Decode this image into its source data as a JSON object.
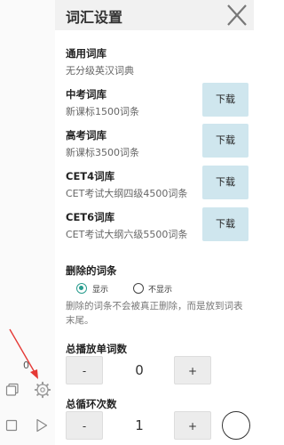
{
  "left_bar": {
    "count": "0"
  },
  "dialog": {
    "title": "词汇设置",
    "general": {
      "title": "通用词库",
      "subtitle": "无分级英汉词典"
    },
    "libraries": [
      {
        "title": "中考词库",
        "subtitle": "新课标1500词条",
        "button": "下载"
      },
      {
        "title": "高考词库",
        "subtitle": "新课标3500词条",
        "button": "下载"
      },
      {
        "title": "CET4词库",
        "subtitle": "CET考试大纲四级4500词条",
        "button": "下载"
      },
      {
        "title": "CET6词库",
        "subtitle": "CET考试大纲六级5500词条",
        "button": "下载"
      }
    ],
    "deleted": {
      "title": "删除的词条",
      "options": [
        {
          "label": "显示",
          "selected": true
        },
        {
          "label": "不显示",
          "selected": false
        }
      ],
      "description": "删除的词条不会被真正删除，而是放到词表末尾。"
    },
    "play_count": {
      "title": "总播放单词数",
      "minus": "-",
      "value": "0",
      "plus": "+"
    },
    "loop_count": {
      "title": "总循环次数",
      "minus": "-",
      "value": "1",
      "plus": "+"
    }
  },
  "colors": {
    "accent": "#2a9d8f",
    "button_bg": "#cfe6ee",
    "arrow": "#e53935"
  }
}
